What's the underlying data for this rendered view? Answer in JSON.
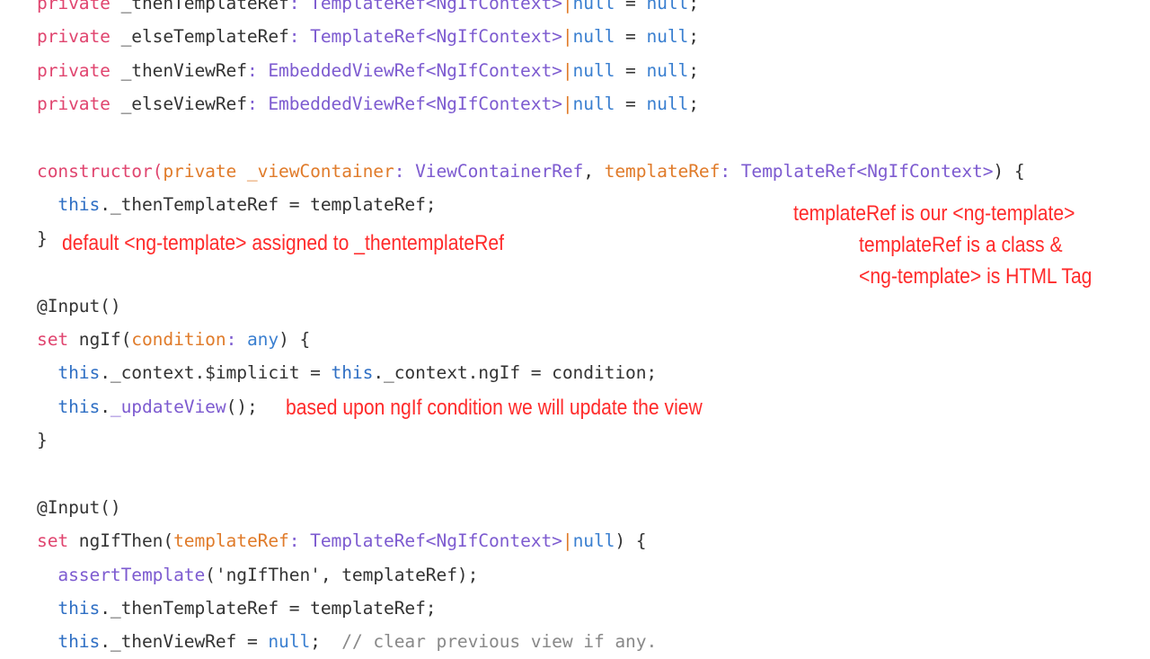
{
  "code_lines": [
    [
      [
        "kw",
        "private "
      ],
      [
        "pl",
        "_thenTemplateRef"
      ],
      [
        "ty",
        ": TemplateRef<NgIfContext>"
      ],
      [
        "pi",
        "|"
      ],
      [
        "nu",
        "null"
      ],
      [
        "pl",
        " = "
      ],
      [
        "nu",
        "null"
      ],
      [
        "pl",
        ";"
      ]
    ],
    [
      [
        "kw",
        "private "
      ],
      [
        "pl",
        "_elseTemplateRef"
      ],
      [
        "ty",
        ": TemplateRef<NgIfContext>"
      ],
      [
        "pi",
        "|"
      ],
      [
        "nu",
        "null"
      ],
      [
        "pl",
        " = "
      ],
      [
        "nu",
        "null"
      ],
      [
        "pl",
        ";"
      ]
    ],
    [
      [
        "kw",
        "private "
      ],
      [
        "pl",
        "_thenViewRef"
      ],
      [
        "ty",
        ": EmbeddedViewRef<NgIfContext>"
      ],
      [
        "pi",
        "|"
      ],
      [
        "nu",
        "null"
      ],
      [
        "pl",
        " = "
      ],
      [
        "nu",
        "null"
      ],
      [
        "pl",
        ";"
      ]
    ],
    [
      [
        "kw",
        "private "
      ],
      [
        "pl",
        "_elseViewRef"
      ],
      [
        "ty",
        ": EmbeddedViewRef<NgIfContext>"
      ],
      [
        "pi",
        "|"
      ],
      [
        "nu",
        "null"
      ],
      [
        "pl",
        " = "
      ],
      [
        "nu",
        "null"
      ],
      [
        "pl",
        ";"
      ]
    ],
    [],
    [
      [
        "kw",
        "constructor("
      ],
      [
        "pa",
        "private _viewContainer"
      ],
      [
        "ty",
        ": ViewContainerRef"
      ],
      [
        "pl",
        ", "
      ],
      [
        "pa",
        "templateRef"
      ],
      [
        "ty",
        ": TemplateRef<NgIfContext>"
      ],
      [
        "pl",
        ") {"
      ]
    ],
    [
      [
        "pl",
        "  "
      ],
      [
        "th",
        "this"
      ],
      [
        "pl",
        "._thenTemplateRef = templateRef;"
      ]
    ],
    [
      [
        "pl",
        "}"
      ]
    ],
    [],
    [
      [
        "pl",
        "@Input()"
      ]
    ],
    [
      [
        "kw",
        "set "
      ],
      [
        "pl",
        "ngIf("
      ],
      [
        "pa",
        "condition"
      ],
      [
        "ty",
        ": "
      ],
      [
        "nu",
        "any"
      ],
      [
        "pl",
        ") {"
      ]
    ],
    [
      [
        "pl",
        "  "
      ],
      [
        "th",
        "this"
      ],
      [
        "pl",
        "._context.$implicit = "
      ],
      [
        "th",
        "this"
      ],
      [
        "pl",
        "._context.ngIf = condition;"
      ]
    ],
    [
      [
        "pl",
        "  "
      ],
      [
        "th",
        "this"
      ],
      [
        "pl",
        "."
      ],
      [
        "fn",
        "_updateView"
      ],
      [
        "pl",
        "();"
      ]
    ],
    [
      [
        "pl",
        "}"
      ]
    ],
    [],
    [
      [
        "pl",
        "@Input()"
      ]
    ],
    [
      [
        "kw",
        "set "
      ],
      [
        "pl",
        "ngIfThen("
      ],
      [
        "pa",
        "templateRef"
      ],
      [
        "ty",
        ": TemplateRef<NgIfContext>"
      ],
      [
        "pi",
        "|"
      ],
      [
        "nu",
        "null"
      ],
      [
        "pl",
        ") {"
      ]
    ],
    [
      [
        "pl",
        "  "
      ],
      [
        "fn",
        "assertTemplate"
      ],
      [
        "pl",
        "('ngIfThen', templateRef);"
      ]
    ],
    [
      [
        "pl",
        "  "
      ],
      [
        "th",
        "this"
      ],
      [
        "pl",
        "._thenTemplateRef = templateRef;"
      ]
    ],
    [
      [
        "pl",
        "  "
      ],
      [
        "th",
        "this"
      ],
      [
        "pl",
        "._thenViewRef = "
      ],
      [
        "nu",
        "null"
      ],
      [
        "pl",
        ";  "
      ],
      [
        "cm",
        "// clear previous view if any."
      ]
    ]
  ],
  "annotations": {
    "default_template": "default <ng-template> assigned to _thentemplateRef",
    "template_ref_1": "templateRef is our <ng-template>",
    "template_ref_2": "templateRef is a class &",
    "template_ref_3": "<ng-template> is HTML Tag",
    "ngif_update": "based upon ngIf condition we will update the view"
  },
  "colors": {
    "annotation": "#ff2a2a",
    "keyword": "#e0456f",
    "type": "#7d5bd0",
    "null": "#3a7fd0",
    "param": "#e07b2a"
  }
}
